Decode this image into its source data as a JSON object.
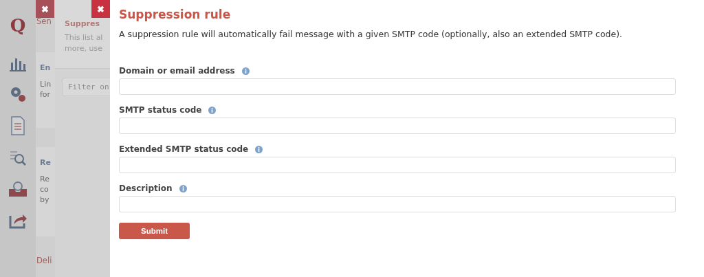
{
  "background_page": {
    "logo": "Q",
    "heading": "Sen",
    "cards": [
      {
        "title": "En",
        "lines": [
          "Lin",
          "for"
        ]
      },
      {
        "title": "Re",
        "lines": [
          "Re",
          "co",
          "by"
        ]
      }
    ],
    "section_heading": "Deli"
  },
  "background_panel": {
    "title": "Suppres",
    "description_lines": [
      "This list al",
      "more, use"
    ],
    "filter": {
      "placeholder": "Filter on"
    }
  },
  "panel": {
    "close": "✖",
    "title": "Suppression rule",
    "description": "A suppression rule will automatically fail message with a given SMTP code (optionally, also an extended SMTP code).",
    "fields": [
      {
        "label": "Domain or email address"
      },
      {
        "label": "SMTP status code"
      },
      {
        "label": "Extended SMTP status code"
      },
      {
        "label": "Description"
      }
    ],
    "submit": "Submit"
  }
}
